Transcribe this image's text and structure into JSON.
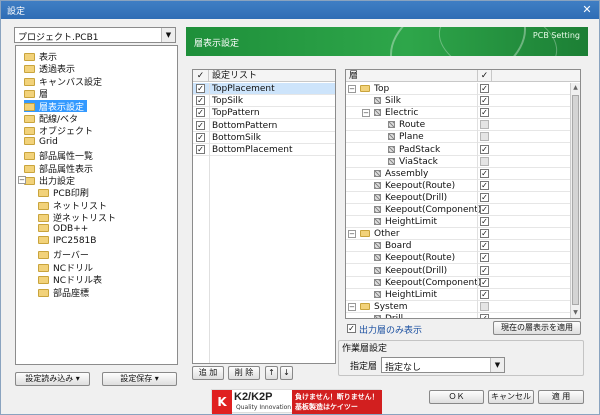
{
  "window": {
    "title": "設定",
    "close_glyph": "✕"
  },
  "project_select": {
    "value": "プロジェクト.PCB1"
  },
  "nav_tree": [
    {
      "label": "表示"
    },
    {
      "label": "透過表示"
    },
    {
      "label": "キャンバス設定"
    },
    {
      "label": "層"
    },
    {
      "label": "層表示設定",
      "selected": true
    },
    {
      "label": "配線/ベタ"
    },
    {
      "label": "オブジェクト"
    },
    {
      "label": "Grid"
    },
    {
      "label": "部品属性一覧"
    },
    {
      "label": "部品属性表示"
    },
    {
      "label": "出力設定",
      "expanded": true
    },
    {
      "label": "PCB印刷"
    },
    {
      "label": "ネットリスト"
    },
    {
      "label": "逆ネットリスト"
    },
    {
      "label": "ODB++"
    },
    {
      "label": "IPC2581B"
    },
    {
      "label": "ガーバー"
    },
    {
      "label": "NCドリル"
    },
    {
      "label": "NCドリル表"
    },
    {
      "label": "部品座標"
    }
  ],
  "left_buttons": {
    "load": "設定読み込み ▾",
    "save": "設定保存 ▾"
  },
  "banner": {
    "title": "層表示設定",
    "right": "PCB Setting"
  },
  "settings_list": {
    "header_check": "✓",
    "header": "設定リスト",
    "items": [
      {
        "label": "TopPlacement",
        "checked": true,
        "selected": true
      },
      {
        "label": "TopSilk",
        "checked": true
      },
      {
        "label": "TopPattern",
        "checked": true
      },
      {
        "label": "BottomPattern",
        "checked": true
      },
      {
        "label": "BottomSilk",
        "checked": true
      },
      {
        "label": "BottomPlacement",
        "checked": true
      }
    ],
    "buttons": {
      "add": "追 加",
      "delete": "削 除",
      "up": "↑",
      "down": "↓"
    }
  },
  "layers": {
    "header": "層",
    "header_check": "✓",
    "items": [
      {
        "label": "Top",
        "indent": 0,
        "type": "folder",
        "exp": "⊟",
        "check": "✓"
      },
      {
        "label": "Silk",
        "indent": 1,
        "type": "leaf",
        "check": "✓"
      },
      {
        "label": "Electric",
        "indent": 1,
        "type": "leaf",
        "exp": "⊟",
        "check": "✓"
      },
      {
        "label": "Route",
        "indent": 2,
        "type": "leaf",
        "check": ""
      },
      {
        "label": "Plane",
        "indent": 2,
        "type": "leaf",
        "check": ""
      },
      {
        "label": "PadStack",
        "indent": 2,
        "type": "leaf",
        "check": "✓"
      },
      {
        "label": "ViaStack",
        "indent": 2,
        "type": "leaf",
        "check": ""
      },
      {
        "label": "Assembly",
        "indent": 1,
        "type": "leaf",
        "check": "✓"
      },
      {
        "label": "Keepout(Route)",
        "indent": 1,
        "type": "leaf",
        "check": "✓"
      },
      {
        "label": "Keepout(Drill)",
        "indent": 1,
        "type": "leaf",
        "check": "✓"
      },
      {
        "label": "Keepout(Component)",
        "indent": 1,
        "type": "leaf",
        "check": "✓"
      },
      {
        "label": "HeightLimit",
        "indent": 1,
        "type": "leaf",
        "check": "✓"
      },
      {
        "label": "Other",
        "indent": 0,
        "type": "folder",
        "exp": "⊟",
        "check": "✓"
      },
      {
        "label": "Board",
        "indent": 1,
        "type": "leaf",
        "check": "✓"
      },
      {
        "label": "Keepout(Route)",
        "indent": 1,
        "type": "leaf",
        "check": "✓"
      },
      {
        "label": "Keepout(Drill)",
        "indent": 1,
        "type": "leaf",
        "check": "✓"
      },
      {
        "label": "Keepout(Component)",
        "indent": 1,
        "type": "leaf",
        "check": "✓"
      },
      {
        "label": "HeightLimit",
        "indent": 1,
        "type": "leaf",
        "check": "✓"
      },
      {
        "label": "System",
        "indent": 0,
        "type": "folder",
        "exp": "⊟",
        "check": ""
      },
      {
        "label": "Drill",
        "indent": 1,
        "type": "leaf",
        "check": "✓"
      }
    ]
  },
  "output_only": {
    "label": "出力層のみ表示",
    "checked": true
  },
  "apply_current_button": "現在の層表示を適用",
  "work_layer": {
    "group_label": "作業層設定",
    "field_label": "指定層",
    "value": "指定なし"
  },
  "logo": {
    "brand": "K2/K2P",
    "sub": "Quality Innovation",
    "line1": "負けません！断りません！",
    "line2": "基板製造はケイツー"
  },
  "dialog_buttons": {
    "ok": "ＯＫ",
    "cancel": "キャンセル",
    "apply": "適 用"
  }
}
